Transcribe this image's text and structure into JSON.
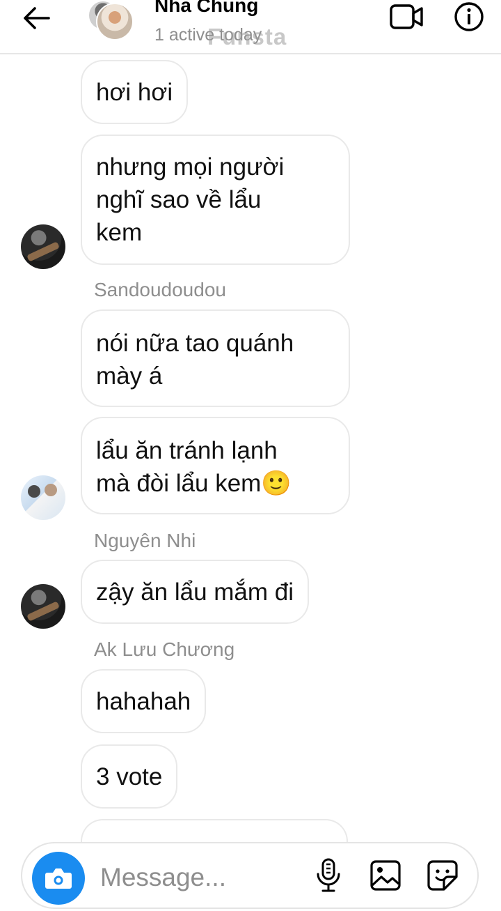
{
  "header": {
    "title": "Nha Chung",
    "subtitle": "1 active today",
    "watermark": "Funsta"
  },
  "messages": [
    {
      "sender": "",
      "text_lines": [
        "hơi hơi"
      ]
    },
    {
      "sender": "",
      "text_lines": [
        "nhưng mọi người",
        "nghĩ sao về lẩu",
        "kem"
      ]
    },
    {
      "sender": "Sandoudoudou",
      "text_lines": [
        "nói nữa tao quánh",
        "mày á"
      ]
    },
    {
      "sender": "",
      "text_lines": [
        "lẩu ăn tránh lạnh",
        "mà đòi lẩu kem🙂"
      ]
    },
    {
      "sender": "Nguyên Nhi",
      "text_lines": [
        "zậy ăn lẩu mắm đi"
      ]
    },
    {
      "sender": "Ak Lưu Chương",
      "text_lines": [
        "hahahah"
      ]
    },
    {
      "sender": "",
      "text_lines": [
        "3 vote"
      ]
    }
  ],
  "composer": {
    "placeholder": "Message..."
  },
  "icons": {
    "back": "arrow-left-icon",
    "video": "video-camera-icon",
    "info": "info-icon",
    "camera": "camera-icon",
    "mic": "microphone-icon",
    "gallery": "image-icon",
    "sticker": "sticker-icon"
  },
  "colors": {
    "accent": "#1a8cf0",
    "secondary_text": "#8e8e8e",
    "bubble_border": "#e9e9e9"
  }
}
